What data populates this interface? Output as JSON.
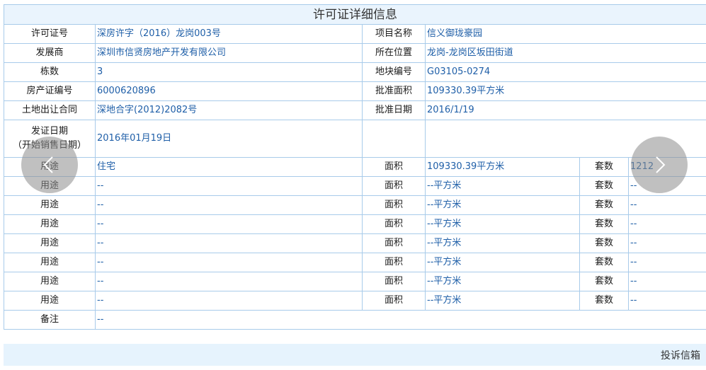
{
  "title": "许可证详细信息",
  "fields": {
    "license_no_label": "许可证号",
    "license_no": "深房许字（2016）龙岗003号",
    "project_label": "项目名称",
    "project": "信义御珑豪园",
    "developer_label": "发展商",
    "developer": "深圳市信贤房地产开发有限公司",
    "location_label": "所在位置",
    "location": "龙岗-龙岗区坂田街道",
    "buildings_label": "栋数",
    "buildings": "3",
    "plot_label": "地块编号",
    "plot": "G03105-0274",
    "cert_label": "房产证编号",
    "cert": "6000620896",
    "area_label": "批准面积",
    "area": "109330.39平方米",
    "land_contract_label": "土地出让合同",
    "land_contract": "深地合字(2012)2082号",
    "approve_date_label": "批准日期",
    "approve_date": "2016/1/19",
    "issue_date_label_1": "发证日期",
    "issue_date_label_2": "（开始销售日期）",
    "issue_date": "2016年01月19日"
  },
  "usage_rows": [
    {
      "use_label": "用途",
      "use": "住宅",
      "area_label": "面积",
      "area": "109330.39平方米",
      "units_label": "套数",
      "units": "1212"
    },
    {
      "use_label": "用途",
      "use": "--",
      "area_label": "面积",
      "area": "--平方米",
      "units_label": "套数",
      "units": "--"
    },
    {
      "use_label": "用途",
      "use": "--",
      "area_label": "面积",
      "area": "--平方米",
      "units_label": "套数",
      "units": "--"
    },
    {
      "use_label": "用途",
      "use": "--",
      "area_label": "面积",
      "area": "--平方米",
      "units_label": "套数",
      "units": "--"
    },
    {
      "use_label": "用途",
      "use": "--",
      "area_label": "面积",
      "area": "--平方米",
      "units_label": "套数",
      "units": "--"
    },
    {
      "use_label": "用途",
      "use": "--",
      "area_label": "面积",
      "area": "--平方米",
      "units_label": "套数",
      "units": "--"
    },
    {
      "use_label": "用途",
      "use": "--",
      "area_label": "面积",
      "area": "--平方米",
      "units_label": "套数",
      "units": "--"
    },
    {
      "use_label": "用途",
      "use": "--",
      "area_label": "面积",
      "area": "--平方米",
      "units_label": "套数",
      "units": "--"
    }
  ],
  "remark_label": "备注",
  "remark": "--",
  "footer": {
    "complaint": "投诉信箱"
  },
  "icons": {
    "prev": "chevron-left-icon",
    "next": "chevron-right-icon"
  },
  "colors": {
    "border": "#a8cbea",
    "value_text": "#1f5fa8",
    "header_bg": "#eaf4fd"
  }
}
